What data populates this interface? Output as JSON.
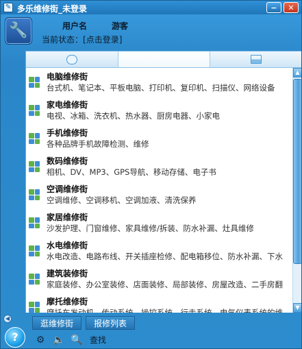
{
  "window": {
    "title": "多乐维修街_未登录"
  },
  "user": {
    "name_label": "用户名",
    "name_value": "游客",
    "status_label": "当前状态：",
    "status_link": "[点击登录]"
  },
  "tabs": [
    {
      "name": "chat",
      "icon": "chat-bubble-icon"
    },
    {
      "name": "list",
      "icon": "list-icon",
      "active": true
    },
    {
      "name": "contact",
      "icon": "contact-card-icon"
    }
  ],
  "categories": [
    {
      "title": "电脑维修街",
      "desc": "台式机、笔记本、平板电脑、打印机、复印机、扫描仪、网络设备"
    },
    {
      "title": "家电维修街",
      "desc": "电视、冰箱、洗衣机、热水器、厨房电器、小家电"
    },
    {
      "title": "手机维修街",
      "desc": "各种品牌手机故障检测、维修"
    },
    {
      "title": "数码维修街",
      "desc": "相机、DV、MP3、GPS导航、移动存储、电子书"
    },
    {
      "title": "空调维修街",
      "desc": "空调维修、空调移机、空调加液、清洗保养"
    },
    {
      "title": "家居维修街",
      "desc": "沙发护理、门窗维修、家具维修/拆装、防水补漏、灶具维修"
    },
    {
      "title": "水电维修街",
      "desc": "水电改造、电路布线、开关插座检修、配电箱移位、防水补漏、下水"
    },
    {
      "title": "建筑装修街",
      "desc": "家庭装修、办公室装修、店面装修、局部装修、房屋改造、二手房翻"
    },
    {
      "title": "摩托维修街",
      "desc": "摩托车发动机、传动系统、操控系统、行走系统、电气仪表系统的维"
    }
  ],
  "bottom_tabs": {
    "browse": "逛维修街",
    "repair_list": "报修列表"
  },
  "toolbar": {
    "search_label": "查找"
  }
}
